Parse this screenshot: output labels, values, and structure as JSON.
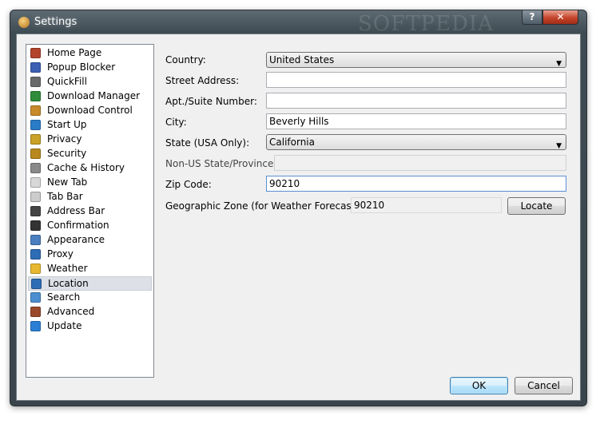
{
  "window": {
    "title": "Settings",
    "watermark": "SOFTPEDIA",
    "help_label": "?",
    "close_label": "✕"
  },
  "colors": {
    "accent": "#3c7fb1",
    "selection": "#dde1e7",
    "titlebar": "#4a565d"
  },
  "sidebar": {
    "selected": "Location",
    "items": [
      {
        "label": "Home Page",
        "icon": "home-icon",
        "color": "#b4432c"
      },
      {
        "label": "Popup Blocker",
        "icon": "popup-blocker-icon",
        "color": "#3c5fb4"
      },
      {
        "label": "QuickFill",
        "icon": "quickfill-icon",
        "color": "#6a6a6a"
      },
      {
        "label": "Download Manager",
        "icon": "download-manager-icon",
        "color": "#2f8c3a"
      },
      {
        "label": "Download Control",
        "icon": "download-control-icon",
        "color": "#c98a2b"
      },
      {
        "label": "Start Up",
        "icon": "start-up-icon",
        "color": "#2a7cc7"
      },
      {
        "label": "Privacy",
        "icon": "privacy-icon",
        "color": "#c9a227"
      },
      {
        "label": "Security",
        "icon": "lock-icon",
        "color": "#b9891f"
      },
      {
        "label": "Cache & History",
        "icon": "clock-icon",
        "color": "#8a8a8a"
      },
      {
        "label": "New Tab",
        "icon": "new-tab-icon",
        "color": "#d8d8d8"
      },
      {
        "label": "Tab Bar",
        "icon": "tab-bar-icon",
        "color": "#cccccc"
      },
      {
        "label": "Address Bar",
        "icon": "address-bar-icon",
        "color": "#444444"
      },
      {
        "label": "Confirmation",
        "icon": "pointing-hand-icon",
        "color": "#333333"
      },
      {
        "label": "Appearance",
        "icon": "appearance-icon",
        "color": "#4a7fc0"
      },
      {
        "label": "Proxy",
        "icon": "proxy-icon",
        "color": "#2d6db5"
      },
      {
        "label": "Weather",
        "icon": "weather-icon",
        "color": "#e8b830"
      },
      {
        "label": "Location",
        "icon": "location-icon",
        "color": "#2d6db5"
      },
      {
        "label": "Search",
        "icon": "search-icon",
        "color": "#4b8fd0"
      },
      {
        "label": "Advanced",
        "icon": "tools-icon",
        "color": "#9a4a2a"
      },
      {
        "label": "Update",
        "icon": "globe-icon",
        "color": "#2a7fd4"
      }
    ]
  },
  "form": {
    "country_label": "Country:",
    "country_value": "United States",
    "street_label": "Street Address:",
    "street_value": "",
    "apt_label": "Apt./Suite Number:",
    "apt_value": "",
    "city_label": "City:",
    "city_value": "Beverly Hills",
    "state_label": "State (USA Only):",
    "state_value": "California",
    "nonus_label": "Non-US State/Province:",
    "nonus_value": "",
    "zip_label": "Zip Code:",
    "zip_value": "90210",
    "zone_label": "Geographic Zone (for Weather Forecast):",
    "zone_value": "90210",
    "locate_label": "Locate"
  },
  "footer": {
    "ok_label": "OK",
    "cancel_label": "Cancel"
  }
}
